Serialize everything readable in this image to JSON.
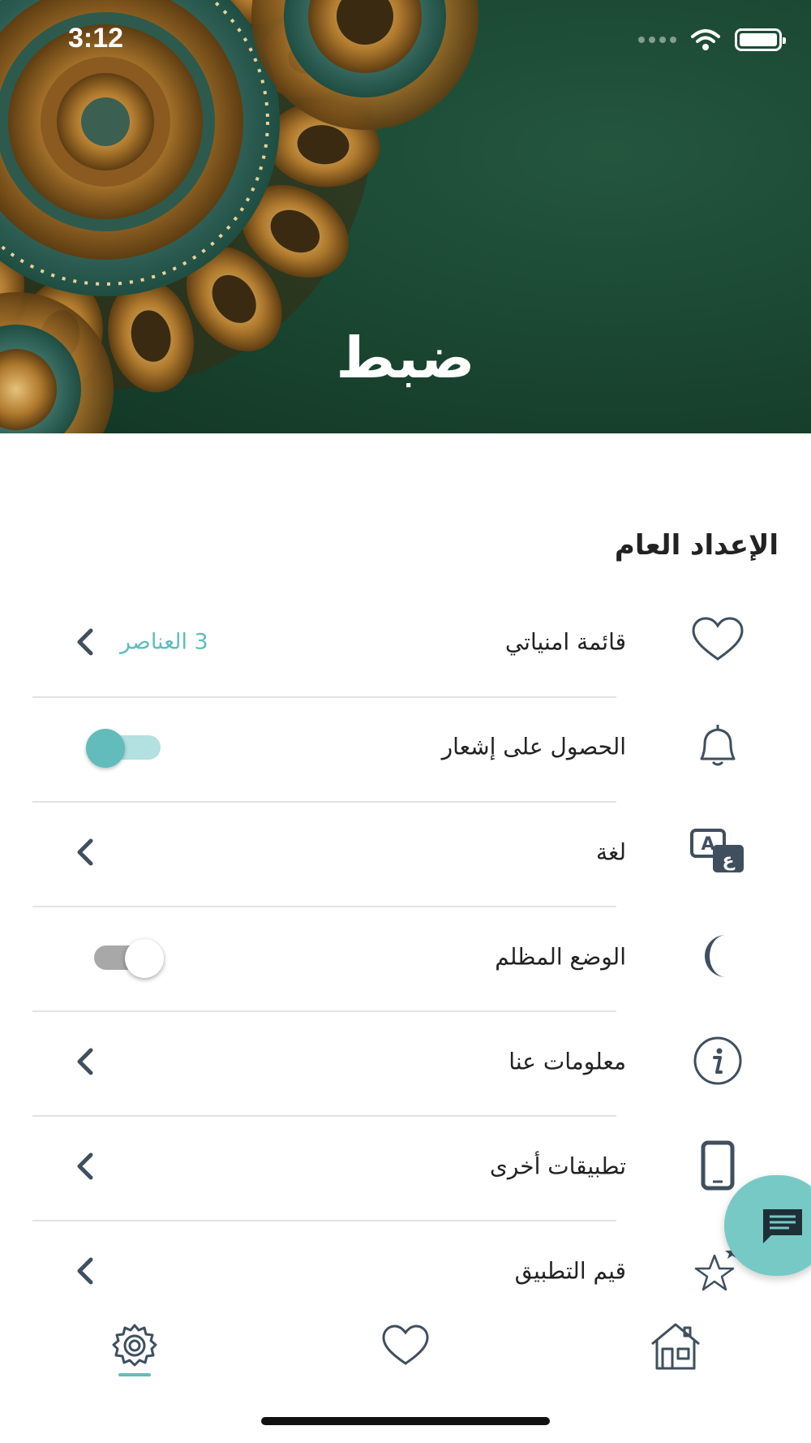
{
  "status_bar": {
    "time": "3:12"
  },
  "header": {
    "title": "ضبط"
  },
  "section": {
    "title": "الإعداد العام"
  },
  "rows": [
    {
      "label": "قائمة امنياتي",
      "icon": "heart-icon",
      "value": "3 العناصر",
      "control": "chevron"
    },
    {
      "label": "الحصول على إشعار",
      "icon": "bell-icon",
      "control": "toggle",
      "toggle_on": true
    },
    {
      "label": "لغة",
      "icon": "language-icon",
      "control": "chevron"
    },
    {
      "label": "الوضع المظلم",
      "icon": "moon-icon",
      "control": "toggle",
      "toggle_on": false
    },
    {
      "label": "معلومات عنا",
      "icon": "info-icon",
      "control": "chevron"
    },
    {
      "label": "تطبيقات أخرى",
      "icon": "phone-icon",
      "control": "chevron"
    },
    {
      "label": "قيم التطبيق",
      "icon": "star-icon",
      "control": "chevron"
    }
  ],
  "bottom_nav": {
    "items": [
      {
        "icon": "gear-icon",
        "active": true
      },
      {
        "icon": "heart-icon",
        "active": false
      },
      {
        "icon": "home-icon",
        "active": false
      }
    ]
  },
  "colors": {
    "accent": "#63bcbc",
    "header_bg": "#1b4833",
    "icon": "#3f4f5e",
    "fab": "#77c9c5"
  }
}
